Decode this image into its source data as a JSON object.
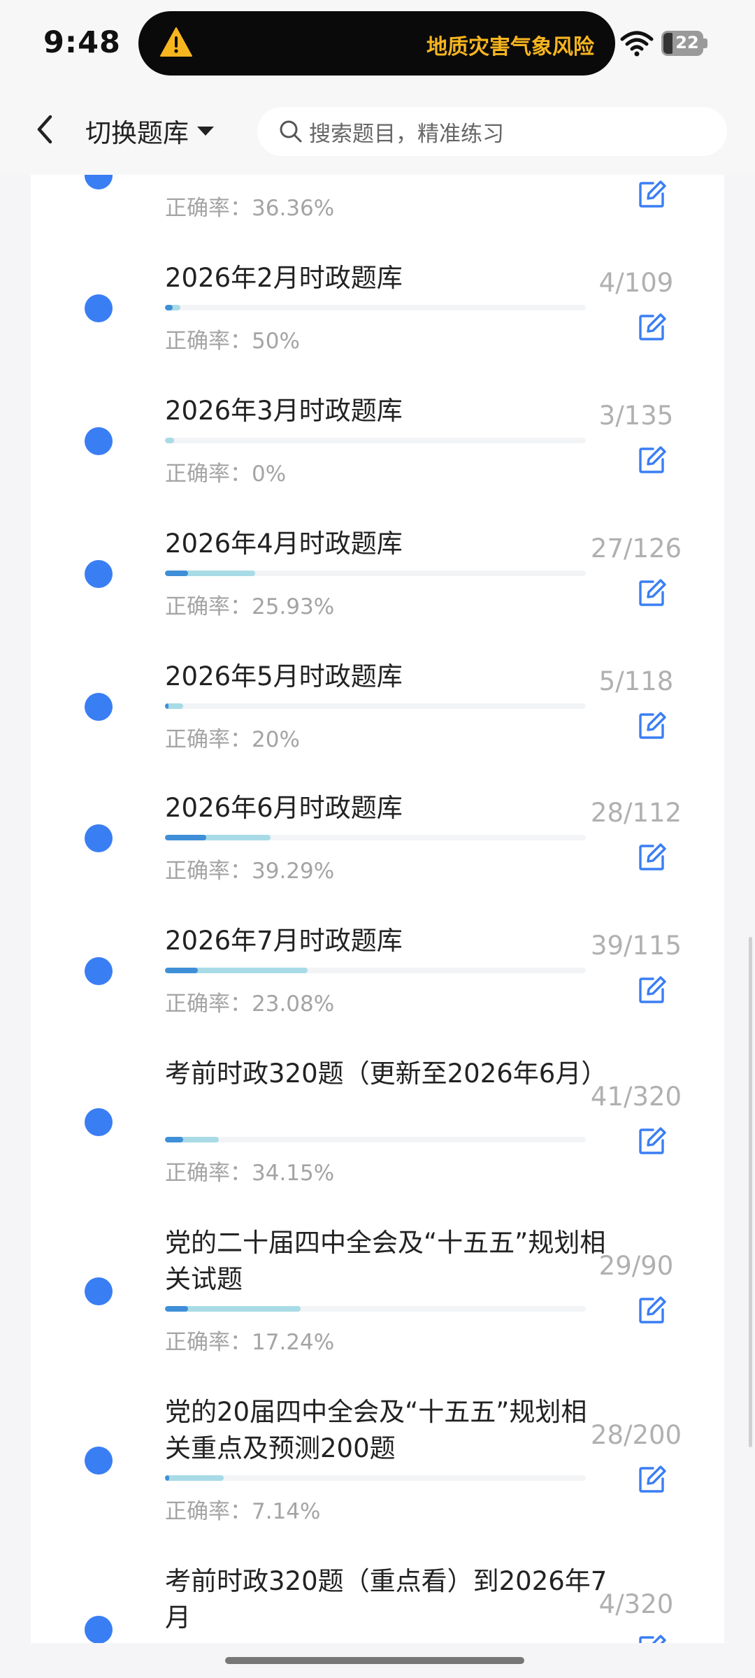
{
  "status_bar": {
    "time": "9:48",
    "alert_icon": "warning-triangle-icon",
    "alert_text": "地质灾害气象风险",
    "wifi_icon": "wifi-icon",
    "battery_level": "22"
  },
  "header": {
    "back_icon": "chevron-left-icon",
    "switch_label": "切换题库",
    "caret_icon": "caret-down-icon",
    "search_icon": "search-icon",
    "search_placeholder": "搜索题目，精准练习"
  },
  "colors": {
    "dot": "#3a7ef4",
    "progress_done": "#a8dbe6",
    "progress_correct": "#3f8fd8",
    "edit_icon": "#3a7ef4"
  },
  "list": {
    "accuracy_prefix": "正确率：",
    "items": [
      {
        "title": "",
        "accuracy": "36.36%",
        "count": "",
        "done": 0,
        "total": 0
      },
      {
        "title": "2026年2月时政题库",
        "accuracy": "50%",
        "count": "4/109",
        "done": 4,
        "total": 109
      },
      {
        "title": "2026年3月时政题库",
        "accuracy": "0%",
        "count": "3/135",
        "done": 3,
        "total": 135
      },
      {
        "title": "2026年4月时政题库",
        "accuracy": "25.93%",
        "count": "27/126",
        "done": 27,
        "total": 126
      },
      {
        "title": "2026年5月时政题库",
        "accuracy": "20%",
        "count": "5/118",
        "done": 5,
        "total": 118
      },
      {
        "title": "2026年6月时政题库",
        "accuracy": "39.29%",
        "count": "28/112",
        "done": 28,
        "total": 112
      },
      {
        "title": "2026年7月时政题库",
        "accuracy": "23.08%",
        "count": "39/115",
        "done": 39,
        "total": 115
      },
      {
        "title": "考前时政320题（更新至2026年6月）",
        "accuracy": "34.15%",
        "count": "41/320",
        "done": 41,
        "total": 320
      },
      {
        "title": "党的二十届四中全会及“十五五”规划相关试题",
        "accuracy": "17.24%",
        "count": "29/90",
        "done": 29,
        "total": 90
      },
      {
        "title": "党的20届四中全会及“十五五”规划相关重点及预测200题",
        "accuracy": "7.14%",
        "count": "28/200",
        "done": 28,
        "total": 200
      },
      {
        "title": "考前时政320题（重点看）到2026年7月",
        "accuracy": "",
        "count": "4/320",
        "done": 4,
        "total": 320
      }
    ]
  }
}
